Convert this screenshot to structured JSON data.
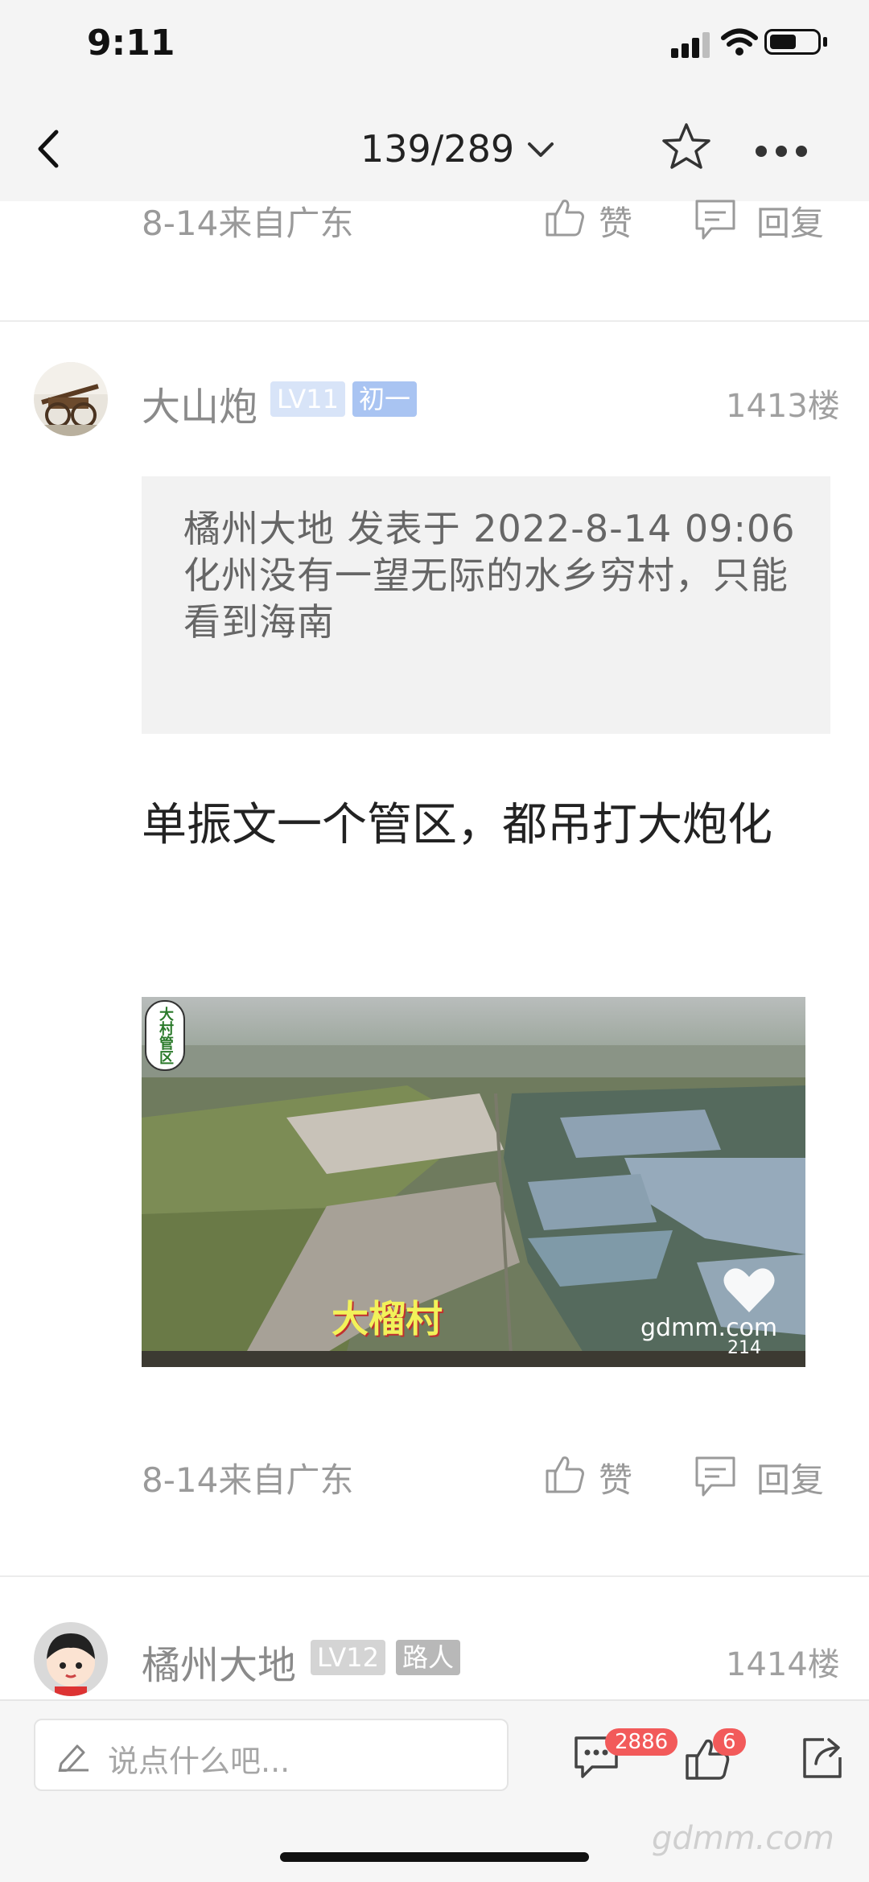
{
  "status_bar": {
    "time": "9:11",
    "icons": [
      "cellular-signal-icon",
      "wifi-icon",
      "battery-icon"
    ]
  },
  "nav": {
    "page_indicator": "139/289",
    "icons": [
      "back-icon",
      "chevron-down-icon",
      "star-icon",
      "more-icon"
    ]
  },
  "prev_post_footer": {
    "date_location": "8-14来自广东",
    "like_label": "赞",
    "reply_label": "回复"
  },
  "post": {
    "username": "大山炮",
    "level": "LV11",
    "rank": "初一",
    "floor": "1413楼",
    "quote": "橘州大地 发表于 2022-8-14 09:06化州没有一望无际的水乡穷村，只能看到海南",
    "body": "单振文一个管区，都吊打大炮化",
    "image": {
      "sticker_text": "大村管区",
      "caption": "大榴村",
      "watermark": "gdmm.com",
      "like_count": "214"
    },
    "footer": {
      "date_location": "8-14来自广东",
      "like_label": "赞",
      "reply_label": "回复"
    }
  },
  "next_post": {
    "username": "橘州大地",
    "level": "LV12",
    "rank": "路人",
    "floor": "1414楼"
  },
  "bottom_bar": {
    "placeholder": "说点什么吧...",
    "comment_count": "2886",
    "like_count": "6"
  },
  "watermark": "gdmm.com",
  "colors": {
    "badge_blue": "#a9c4f2",
    "badge_gray": "#c8c8c8",
    "count_red": "#f25a5a"
  }
}
